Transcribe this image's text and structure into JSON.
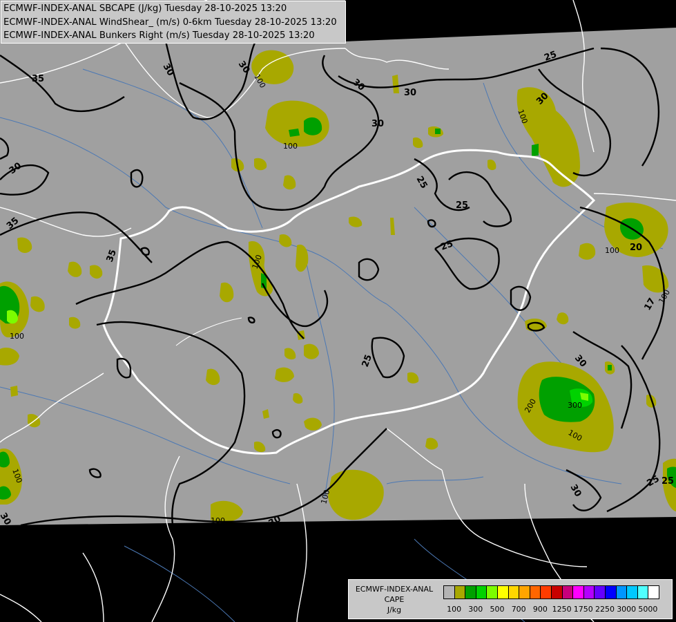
{
  "header": {
    "line1": "ECMWF-INDEX-ANAL SBCAPE (J/kg) Tuesday 28-10-2025 13:20",
    "line2": "ECMWF-INDEX-ANAL WindShear_ (m/s) 0-6km Tuesday 28-10-2025 13:20",
    "line3": "ECMWF-INDEX-ANAL Bunkers Right (m/s) Tuesday 28-10-2025 13:20"
  },
  "legend": {
    "title1": "ECMWF-INDEX-ANAL",
    "title2": "CAPE",
    "title3": "J/kg",
    "colors": [
      "#b4b4b4",
      "#a8a800",
      "#00a000",
      "#00d200",
      "#7cfc00",
      "#ffff00",
      "#ffd700",
      "#ffa500",
      "#ff6600",
      "#ff3c00",
      "#c80000",
      "#c8007c",
      "#ff00ff",
      "#b400ff",
      "#6400ff",
      "#0000ff",
      "#0096ff",
      "#00c8ff",
      "#50ffff",
      "#ffffff"
    ],
    "ticks": [
      "100",
      "300",
      "500",
      "700",
      "900",
      "1250",
      "1750",
      "2250",
      "3000",
      "5000"
    ]
  },
  "map_labels": {
    "shear": [
      "35",
      "30",
      "30",
      "30",
      "30",
      "35",
      "35",
      "30",
      "30",
      "25",
      "25",
      "25",
      "25",
      "25",
      "25",
      "30",
      "30",
      "20",
      "17",
      "30",
      "25",
      "30",
      "30"
    ],
    "cape": [
      "100",
      "100",
      "100",
      "100",
      "100",
      "100",
      "200",
      "300",
      "100",
      "100",
      "100",
      "100",
      "100"
    ]
  },
  "colors": {
    "background_land": "#a0a0a0",
    "outside_domain": "#000000",
    "cape_low": "#a8a800",
    "cape_mid": "#00a000",
    "cape_high": "#7cfc00",
    "border": "#ffffff",
    "river": "#4b78b4",
    "contour": "#000000"
  }
}
